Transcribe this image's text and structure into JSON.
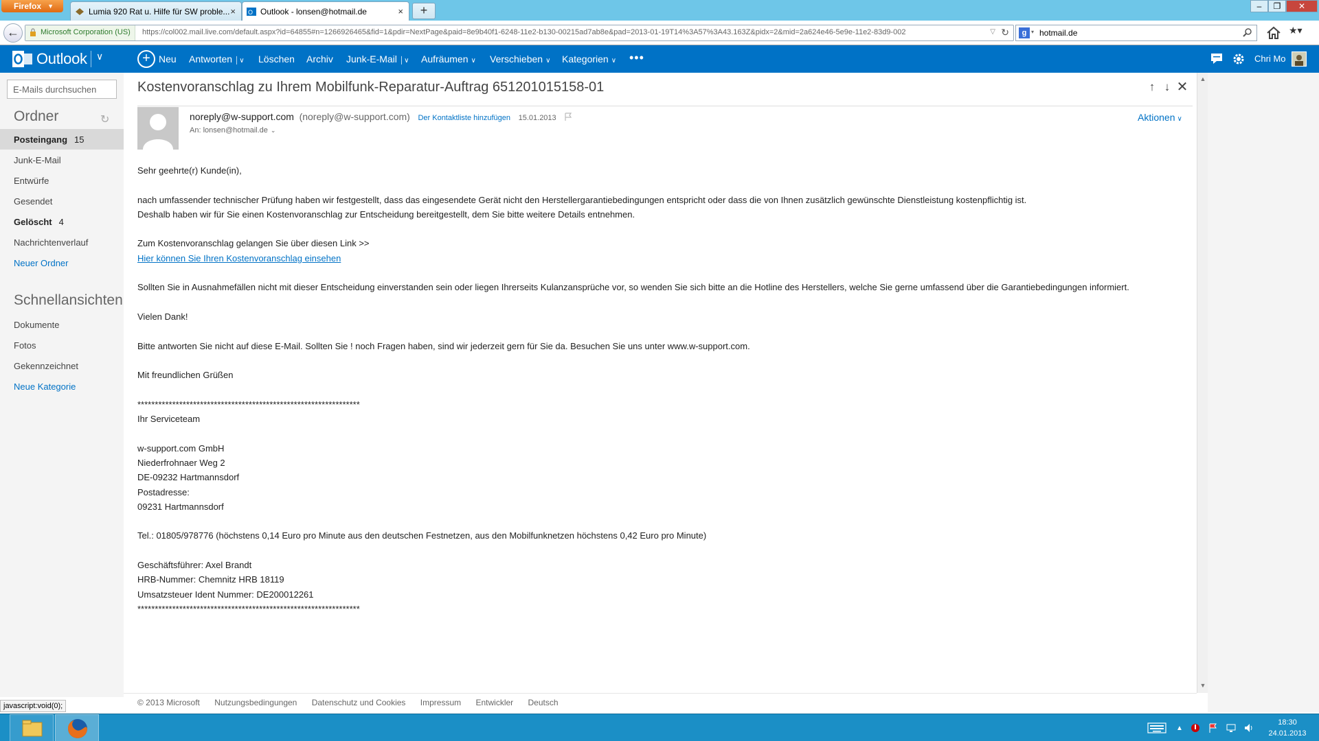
{
  "browser": {
    "menu_label": "Firefox",
    "tabs": [
      {
        "title": "Lumia 920 Rat u. Hilfe für SW proble...",
        "active": false
      },
      {
        "title": "Outlook - lonsen@hotmail.de",
        "active": true
      }
    ],
    "new_tab": "+",
    "identity": "Microsoft Corporation (US)",
    "url": "https://col002.mail.live.com/default.aspx?id=64855#n=1266926465&fid=1&pdir=NextPage&paid=8e9b40f1-6248-11e2-b130-00215ad7ab8e&pad=2013-01-19T14%3A57%3A43.163Z&pidx=2&mid=2a624e46-5e9e-11e2-83d9-002",
    "search_value": "hotmail.de",
    "status_url": "javascript:void(0);"
  },
  "header": {
    "brand": "Outlook",
    "commands": {
      "new": "Neu",
      "reply": "Antworten",
      "delete": "Löschen",
      "archive": "Archiv",
      "junk": "Junk-E-Mail",
      "sweep": "Aufräumen",
      "move": "Verschieben",
      "categories": "Kategorien",
      "more": "•••"
    },
    "user": "Chri Mo"
  },
  "sidebar": {
    "search_placeholder": "E-Mails durchsuchen",
    "folders_heading": "Ordner",
    "folders": [
      {
        "label": "Posteingang",
        "count": "15"
      },
      {
        "label": "Junk-E-Mail",
        "count": ""
      },
      {
        "label": "Entwürfe",
        "count": ""
      },
      {
        "label": "Gesendet",
        "count": ""
      },
      {
        "label": "Gelöscht",
        "count": "4"
      },
      {
        "label": "Nachrichtenverlauf",
        "count": ""
      },
      {
        "label": "Neuer Ordner",
        "count": ""
      }
    ],
    "quick_heading": "Schnellansichten",
    "quick_views": [
      {
        "label": "Dokumente"
      },
      {
        "label": "Fotos"
      },
      {
        "label": "Gekennzeichnet"
      },
      {
        "label": "Neue Kategorie"
      }
    ]
  },
  "message": {
    "subject": "Kostenvoranschlag zu Ihrem Mobilfunk-Reparatur-Auftrag 651201015158-01",
    "sender_name": "noreply@w-support.com",
    "sender_addr": "(noreply@w-support.com)",
    "add_contact": "Der Kontaktliste hinzufügen",
    "date": "15.01.2013",
    "to": "An: lonsen@hotmail.de",
    "actions": "Aktionen",
    "body": {
      "greeting": "Sehr geehrte(r) Kunde(in),",
      "p1_line1": "nach umfassender technischer Prüfung haben wir festgestellt, dass das eingesendete Gerät nicht den Herstellergarantiebedingungen entspricht oder dass die von Ihnen zusätzlich gewünschte Dienstleistung kostenpflichtig ist.",
      "p1_line2": "Deshalb haben wir für Sie einen Kostenvoranschlag zur Entscheidung bereitgestellt, dem Sie bitte weitere Details entnehmen.",
      "link_intro": "Zum Kostenvoranschlag gelangen Sie über diesen Link >>",
      "link_text": "Hier können Sie Ihren Kostenvoranschlag einsehen",
      "p2": "Sollten Sie in Ausnahmefällen nicht mit dieser Entscheidung einverstanden sein oder liegen Ihrerseits Kulanzansprüche vor, so wenden Sie sich bitte an die Hotline des Herstellers, welche Sie gerne umfassend über die Garantiebedingungen informiert.",
      "thanks": "Vielen Dank!",
      "p3": "Bitte antworten Sie nicht auf diese E-Mail. Sollten Sie ! noch Fragen haben, sind wir jederzeit gern für Sie da. Besuchen Sie uns unter www.w-support.com.",
      "closing": "Mit freundlichen Grüßen",
      "stars": "****************************************************************",
      "team": "Ihr Serviceteam",
      "company": "w-support.com GmbH",
      "street": "Niederfrohnaer Weg 2",
      "city": "DE-09232 Hartmannsdorf",
      "postal_label": "Postadresse:",
      "postal_city": "09231 Hartmannsdorf",
      "phone": "Tel.: 01805/978776 (höchstens 0,14 Euro pro Minute aus den deutschen Festnetzen, aus den Mobilfunknetzen höchstens 0,42 Euro pro Minute)",
      "ceo": "Geschäftsführer: Axel Brandt",
      "hrb": "HRB-Nummer: Chemnitz HRB 18119",
      "vat": "Umsatzsteuer Ident Nummer: DE200012261",
      "stars_end": "****************************************************************"
    }
  },
  "footer": {
    "items": [
      "© 2013 Microsoft",
      "Nutzungsbedingungen",
      "Datenschutz und Cookies",
      "Impressum",
      "Entwickler",
      "Deutsch"
    ]
  },
  "taskbar": {
    "time": "18:30",
    "date": "24.01.2013"
  },
  "colors": {
    "outlook_blue": "#0072c6",
    "taskbar": "#1b8fc6",
    "titlebar": "#6ec6e8"
  }
}
